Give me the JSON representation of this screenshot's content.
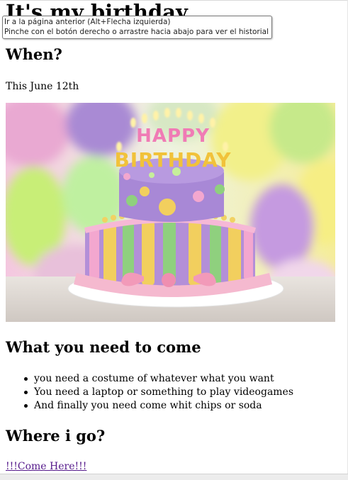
{
  "title": "It's my birthday",
  "tooltip": {
    "line1": "Ir a la página anterior (Alt+Flecha izquierda)",
    "line2": "Pinche con el botón derecho o arrastre hacia abajo para ver el historial"
  },
  "when": {
    "heading": "When?",
    "text": "This June 12th"
  },
  "cake_image": {
    "alt": "Birthday cake",
    "candle_letters": "HAPPY BIRTHDAY"
  },
  "needs": {
    "heading": "What you need to come",
    "items": [
      {
        "text": "you need a costume of whatever what you want"
      },
      {
        "text": "You need a laptop or something to play videogames"
      },
      {
        "text": "And finally you need come whit chips or soda"
      }
    ]
  },
  "where": {
    "heading": "Where i go?",
    "link_text": "!!!Come Here!!!"
  },
  "colors": {
    "link": "#551a8b",
    "tooltip_border": "#767676"
  }
}
